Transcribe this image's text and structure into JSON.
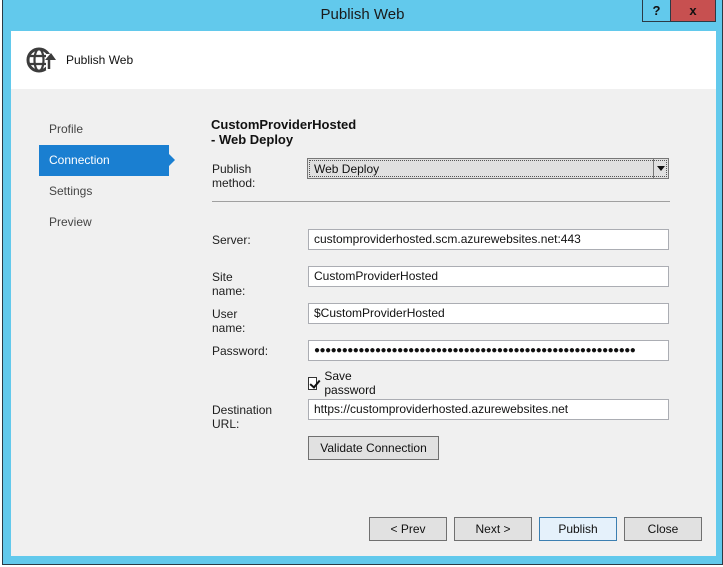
{
  "window": {
    "title": "Publish Web",
    "help_label": "?",
    "close_label": "x"
  },
  "header": {
    "icon": "globe-publish-icon",
    "title": "Publish Web"
  },
  "nav": {
    "items": [
      {
        "label": "Profile",
        "active": false
      },
      {
        "label": "Connection",
        "active": true
      },
      {
        "label": "Settings",
        "active": false
      },
      {
        "label": "Preview",
        "active": false
      }
    ]
  },
  "main": {
    "profile_title": "CustomProviderHosted - Web Deploy",
    "publish_method": {
      "label": "Publish method:",
      "value": "Web Deploy"
    },
    "server": {
      "label": "Server:",
      "value": "customproviderhosted.scm.azurewebsites.net:443"
    },
    "site_name": {
      "label": "Site name:",
      "value": "CustomProviderHosted"
    },
    "user_name": {
      "label": "User name:",
      "value": "$CustomProviderHosted"
    },
    "password": {
      "label": "Password:",
      "value": "●●●●●●●●●●●●●●●●●●●●●●●●●●●●●●●●●●●●●●●●●●●●●●●●●●●●●●●●●●"
    },
    "save_password": {
      "label": "Save password",
      "checked": true
    },
    "destination_url": {
      "label": "Destination URL:",
      "value": "https://customproviderhosted.azurewebsites.net"
    },
    "validate_label": "Validate Connection"
  },
  "footer": {
    "prev_label": "< Prev",
    "next_label": "Next >",
    "publish_label": "Publish",
    "close_label": "Close"
  },
  "colors": {
    "title_bar": "#62c9ec",
    "close_button": "#c75050",
    "nav_active": "#1a7fd1"
  }
}
